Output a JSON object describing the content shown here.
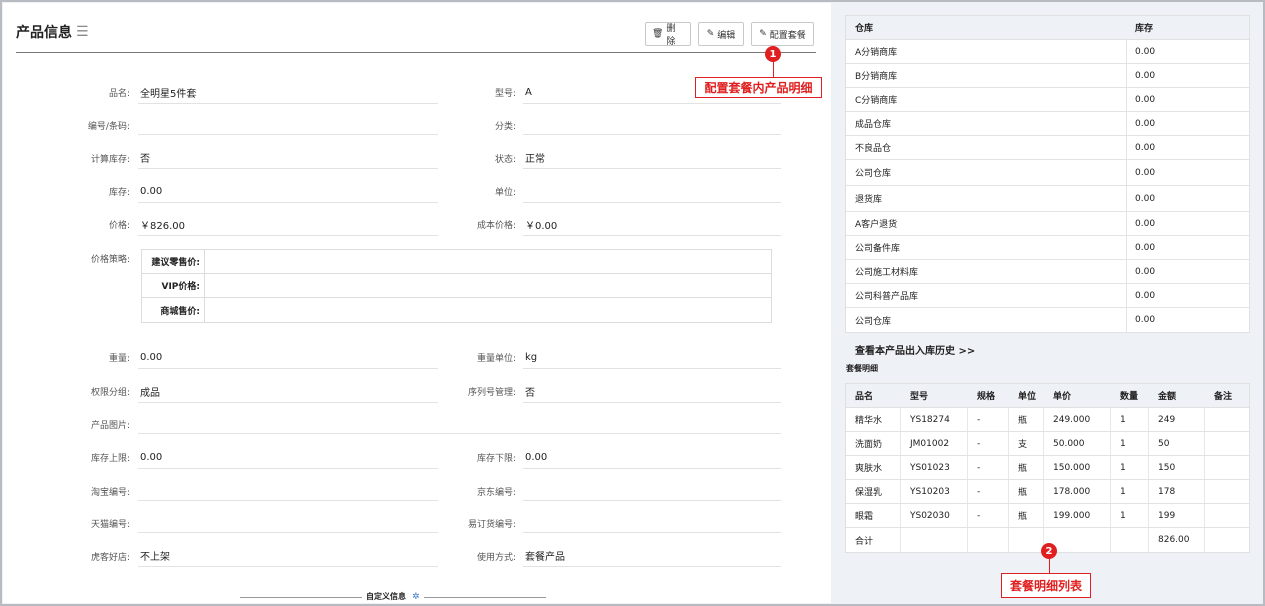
{
  "header": {
    "title": "产品信息",
    "menu_icon": "☰",
    "delete_label": "删除",
    "edit_label": "编辑",
    "config_label": "配置套餐"
  },
  "callouts": {
    "one": {
      "badge": "1",
      "text": "配置套餐内产品明细"
    },
    "two": {
      "badge": "2",
      "text": "套餐明细列表"
    }
  },
  "fields": {
    "name": {
      "label": "品名:",
      "value": "全明星5件套"
    },
    "model": {
      "label": "型号:",
      "value": "A"
    },
    "barcode": {
      "label": "编号/条码:",
      "value": ""
    },
    "category": {
      "label": "分类:",
      "value": ""
    },
    "calc_stock": {
      "label": "计算库存:",
      "value": "否"
    },
    "status": {
      "label": "状态:",
      "value": "正常"
    },
    "stock": {
      "label": "库存:",
      "value": "0.00"
    },
    "unit": {
      "label": "单位:",
      "value": ""
    },
    "price": {
      "label": "价格:",
      "value": "￥826.00"
    },
    "cost": {
      "label": "成本价格:",
      "value": "￥0.00"
    },
    "price_policy": {
      "label": "价格策略:"
    },
    "weight": {
      "label": "重量:",
      "value": "0.00"
    },
    "weight_unit": {
      "label": "重量单位:",
      "value": "kg"
    },
    "perm_group": {
      "label": "权限分组:",
      "value": "成品"
    },
    "serial_mgmt": {
      "label": "序列号管理:",
      "value": "否"
    },
    "image": {
      "label": "产品图片:",
      "value": ""
    },
    "stock_max": {
      "label": "库存上限:",
      "value": "0.00"
    },
    "stock_min": {
      "label": "库存下限:",
      "value": "0.00"
    },
    "taobao": {
      "label": "淘宝编号:",
      "value": ""
    },
    "jd": {
      "label": "京东编号:",
      "value": ""
    },
    "tmall": {
      "label": "天猫编号:",
      "value": ""
    },
    "yidinghuo": {
      "label": "易订货编号:",
      "value": ""
    },
    "huke": {
      "label": "虎客好店:",
      "value": "不上架"
    },
    "usage": {
      "label": "使用方式:",
      "value": "套餐产品"
    }
  },
  "price_table": [
    {
      "label": "建议零售价:",
      "value": ""
    },
    {
      "label": "VIP价格:",
      "value": ""
    },
    {
      "label": "商城售价:",
      "value": ""
    }
  ],
  "custom_section": {
    "label": "自定义信息"
  },
  "warehouse": {
    "headers": [
      "仓库",
      "库存"
    ],
    "rows": [
      [
        "A分销商库",
        "0.00"
      ],
      [
        "B分销商库",
        "0.00"
      ],
      [
        "C分销商库",
        "0.00"
      ],
      [
        "成品仓库",
        "0.00"
      ],
      [
        "不良品仓",
        "0.00"
      ],
      [
        "公司仓库",
        "0.00"
      ],
      [
        "退货库",
        "0.00"
      ],
      [
        "A客户退货",
        "0.00"
      ],
      [
        "公司备件库",
        "0.00"
      ],
      [
        "公司施工材料库",
        "0.00"
      ],
      [
        "公司科普产品库",
        "0.00"
      ],
      [
        "公司仓库",
        "0.00"
      ]
    ],
    "history_link": "查看本产品出入库历史 >>"
  },
  "bundle": {
    "title": "套餐明细",
    "headers": [
      "品名",
      "型号",
      "规格",
      "单位",
      "单价",
      "数量",
      "金额",
      "备注"
    ],
    "rows": [
      [
        "精华水",
        "YS18274",
        "-",
        "瓶",
        "249.000",
        "1",
        "249",
        ""
      ],
      [
        "洗面奶",
        "JM01002",
        "-",
        "支",
        "50.000",
        "1",
        "50",
        ""
      ],
      [
        "爽肤水",
        "YS01023",
        "-",
        "瓶",
        "150.000",
        "1",
        "150",
        ""
      ],
      [
        "保湿乳",
        "YS10203",
        "-",
        "瓶",
        "178.000",
        "1",
        "178",
        ""
      ],
      [
        "眼霜",
        "YS02030",
        "-",
        "瓶",
        "199.000",
        "1",
        "199",
        ""
      ]
    ],
    "total_row": [
      "合计",
      "",
      "",
      "",
      "",
      "",
      "826.00",
      ""
    ]
  }
}
